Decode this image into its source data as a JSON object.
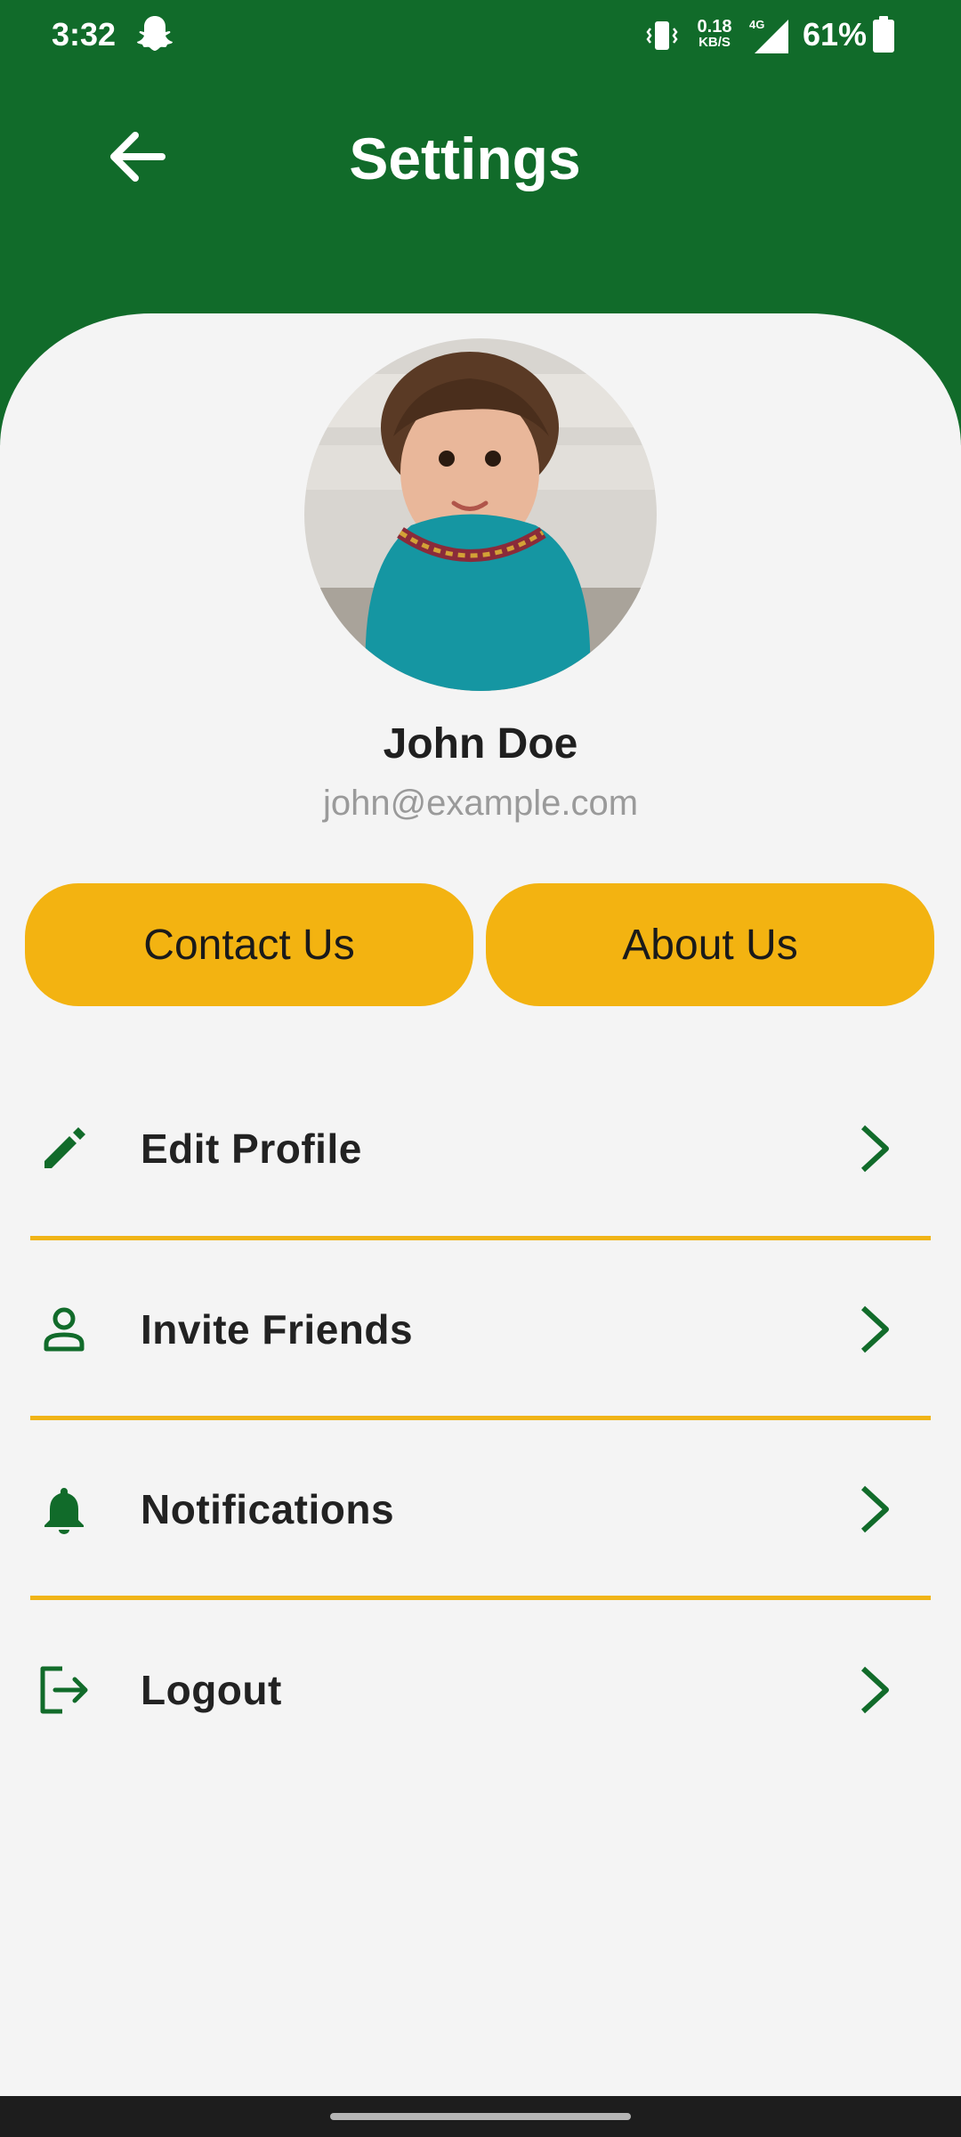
{
  "status_bar": {
    "time": "3:32",
    "net_speed_value": "0.18",
    "net_speed_unit": "KB/S",
    "network_type": "4G",
    "battery": "61%"
  },
  "header": {
    "title": "Settings",
    "back_icon": "arrow-left-icon"
  },
  "profile": {
    "name": "John Doe",
    "email": "john@example.com"
  },
  "actions": {
    "contact_label": "Contact Us",
    "about_label": "About Us"
  },
  "menu": [
    {
      "label": "Edit Profile",
      "icon": "pencil-icon"
    },
    {
      "label": "Invite Friends",
      "icon": "person-icon"
    },
    {
      "label": "Notifications",
      "icon": "bell-icon"
    },
    {
      "label": "Logout",
      "icon": "logout-icon"
    }
  ],
  "colors": {
    "header_green": "#116b2a",
    "accent_yellow": "#f3b311",
    "background": "#f4f4f4"
  }
}
